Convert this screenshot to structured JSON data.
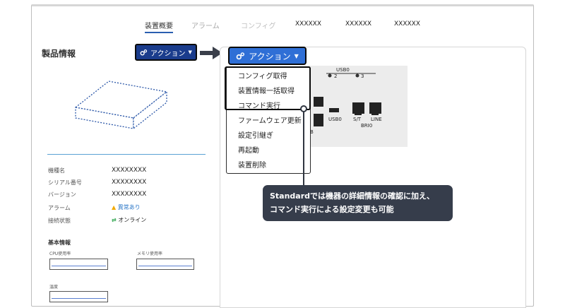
{
  "tabs": [
    "装置概要",
    "アラーム",
    "コンフィグ",
    "XXXXXX",
    "XXXXXX",
    "XXXXXX"
  ],
  "left_title": "製品情報",
  "action_button_label": "アクション",
  "device_labels": {
    "usb0_top": "USB0",
    "port2": "2",
    "port3": "3",
    "usb0_bottom": "USB0",
    "st": "S/T",
    "line": "LINE",
    "bri0": "BRI0",
    "partial_b": "B"
  },
  "menu_items": [
    "コンフィグ取得",
    "装置情報一括取得",
    "コマンド実行",
    "ファームウェア更新",
    "設定引継ぎ",
    "再起動",
    "装置削除"
  ],
  "callout_lines": [
    "Standardでは機器の詳細情報の確認に加え、",
    "コマンド実行による設定変更も可能"
  ],
  "info": [
    {
      "label": "機種名",
      "value": "XXXXXXXX"
    },
    {
      "label": "シリアル番号",
      "value": "XXXXXXXX"
    },
    {
      "label": "バージョン",
      "value": "XXXXXXXX"
    },
    {
      "label": "アラーム",
      "value": "異常あり"
    },
    {
      "label": "接続状態",
      "value": "オンライン"
    }
  ],
  "basic_info": {
    "title": "基本情報",
    "cpu_label": "CPU使用率",
    "mem_label": "メモリ使用率",
    "temp_label": "温度"
  },
  "colors": {
    "button_small": "#1a3c8c",
    "button_big": "#2f6fd6",
    "callout_bg": "#363d4b",
    "accent_line": "#5aa1d4"
  }
}
